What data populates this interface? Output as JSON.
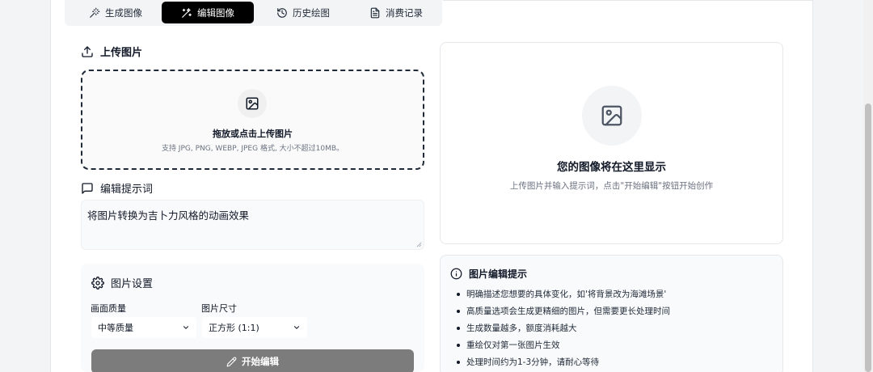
{
  "tabs": [
    {
      "label": "生成图像",
      "icon": "magic-wand-icon",
      "active": false
    },
    {
      "label": "编辑图像",
      "icon": "edit-wand-icon",
      "active": true
    },
    {
      "label": "历史绘图",
      "icon": "history-icon",
      "active": false
    },
    {
      "label": "消费记录",
      "icon": "document-icon",
      "active": false
    }
  ],
  "upload": {
    "heading": "上传图片",
    "drop_title": "拖放或点击上传图片",
    "drop_hint": "支持 JPG, PNG, WEBP, JPEG 格式, 大小不超过10MB。"
  },
  "prompt": {
    "heading": "编辑提示词",
    "value": "将图片转换为吉卜力风格的动画效果"
  },
  "settings": {
    "heading": "图片设置",
    "quality_label": "画面质量",
    "quality_value": "中等质量",
    "size_label": "图片尺寸",
    "size_value": "正方形 (1:1)",
    "start_button": "开始编辑"
  },
  "preview": {
    "title": "您的图像将在这里显示",
    "subtitle": "上传图片并输入提示词，点击\"开始编辑\"按钮开始创作"
  },
  "tips": {
    "heading": "图片编辑提示",
    "items": [
      "明确描述您想要的具体变化，如'将背景改为海滩场景'",
      "高质量选项会生成更精细的图片，但需要更长处理时间",
      "生成数量越多，额度消耗越大",
      "重绘仅对第一张图片生效",
      "处理时间约为1-3分钟，请耐心等待"
    ]
  },
  "colors": {
    "active_tab": "#000000",
    "start_button": "#7c7c7c",
    "panel_bg": "#f9fafb",
    "border": "#e5e7eb"
  }
}
